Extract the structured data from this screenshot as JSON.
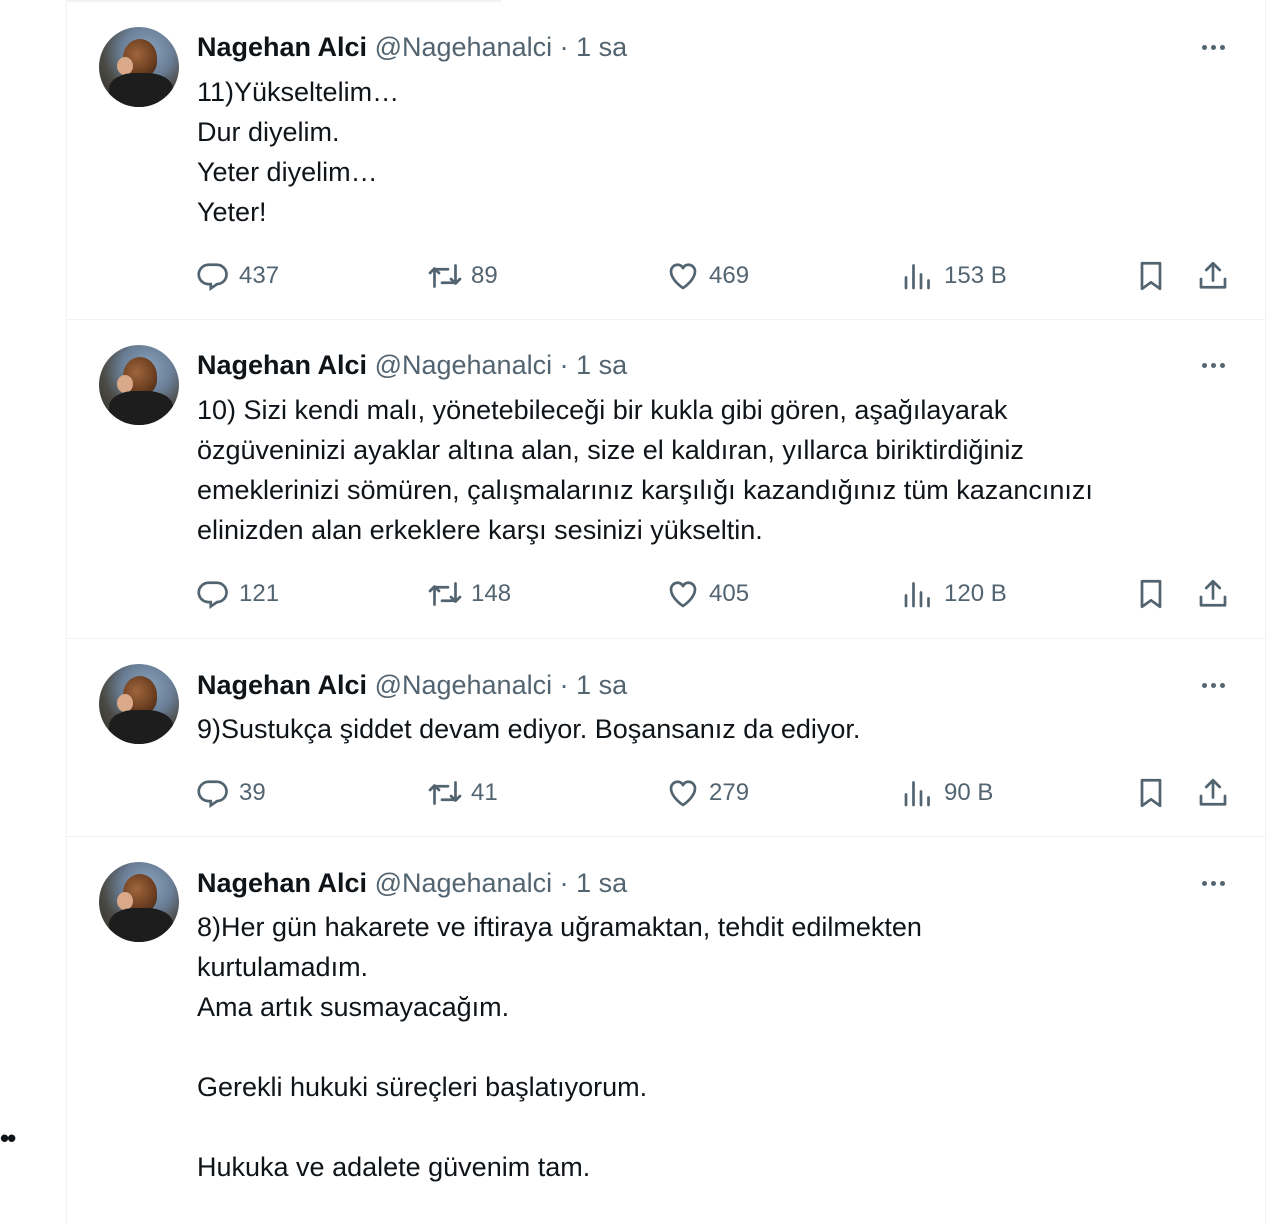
{
  "tweets": [
    {
      "name": "Nagehan Alci",
      "handle": "@Nagehanalci",
      "separator": "·",
      "time": "1 sa",
      "lines": [
        "11)Yükseltelim…",
        "Dur diyelim.",
        "Yeter diyelim…",
        "Yeter!"
      ],
      "replies": "437",
      "retweets": "89",
      "likes": "469",
      "views": "153 B"
    },
    {
      "name": "Nagehan Alci",
      "handle": "@Nagehanalci",
      "separator": "·",
      "time": "1 sa",
      "lines": [
        "10) Sizi kendi malı, yönetebileceği bir kukla gibi gören, aşağılayarak",
        "özgüveninizi ayaklar altına alan, size el kaldıran, yıllarca biriktirdiğiniz",
        "emeklerinizi sömüren, çalışmalarınız karşılığı kazandığınız tüm kazancınızı",
        "elinizden alan erkeklere karşı sesinizi yükseltin."
      ],
      "replies": "121",
      "retweets": "148",
      "likes": "405",
      "views": "120 B"
    },
    {
      "name": "Nagehan Alci",
      "handle": "@Nagehanalci",
      "separator": "·",
      "time": "1 sa",
      "lines": [
        "9)Sustukça şiddet devam ediyor. Boşansanız da ediyor."
      ],
      "replies": "39",
      "retweets": "41",
      "likes": "279",
      "views": "90 B"
    },
    {
      "name": "Nagehan Alci",
      "handle": "@Nagehanalci",
      "separator": "·",
      "time": "1 sa",
      "lines": [
        "8)Her gün hakarete ve iftiraya uğramaktan, tehdit edilmekten",
        "kurtulamadım.",
        "Ama artık susmayacağım.",
        "",
        "Gerekli hukuki süreçleri başlatıyorum.",
        "",
        "Hukuka ve adalete güvenim tam."
      ]
    }
  ],
  "icons": {
    "reply": "reply-icon",
    "retweet": "retweet-icon",
    "like": "heart-icon",
    "views": "views-icon",
    "bookmark": "bookmark-icon",
    "share": "share-icon",
    "more": "more-icon"
  },
  "colors": {
    "text": "#0f1419",
    "secondary": "#536471",
    "border": "#eff3f4"
  }
}
